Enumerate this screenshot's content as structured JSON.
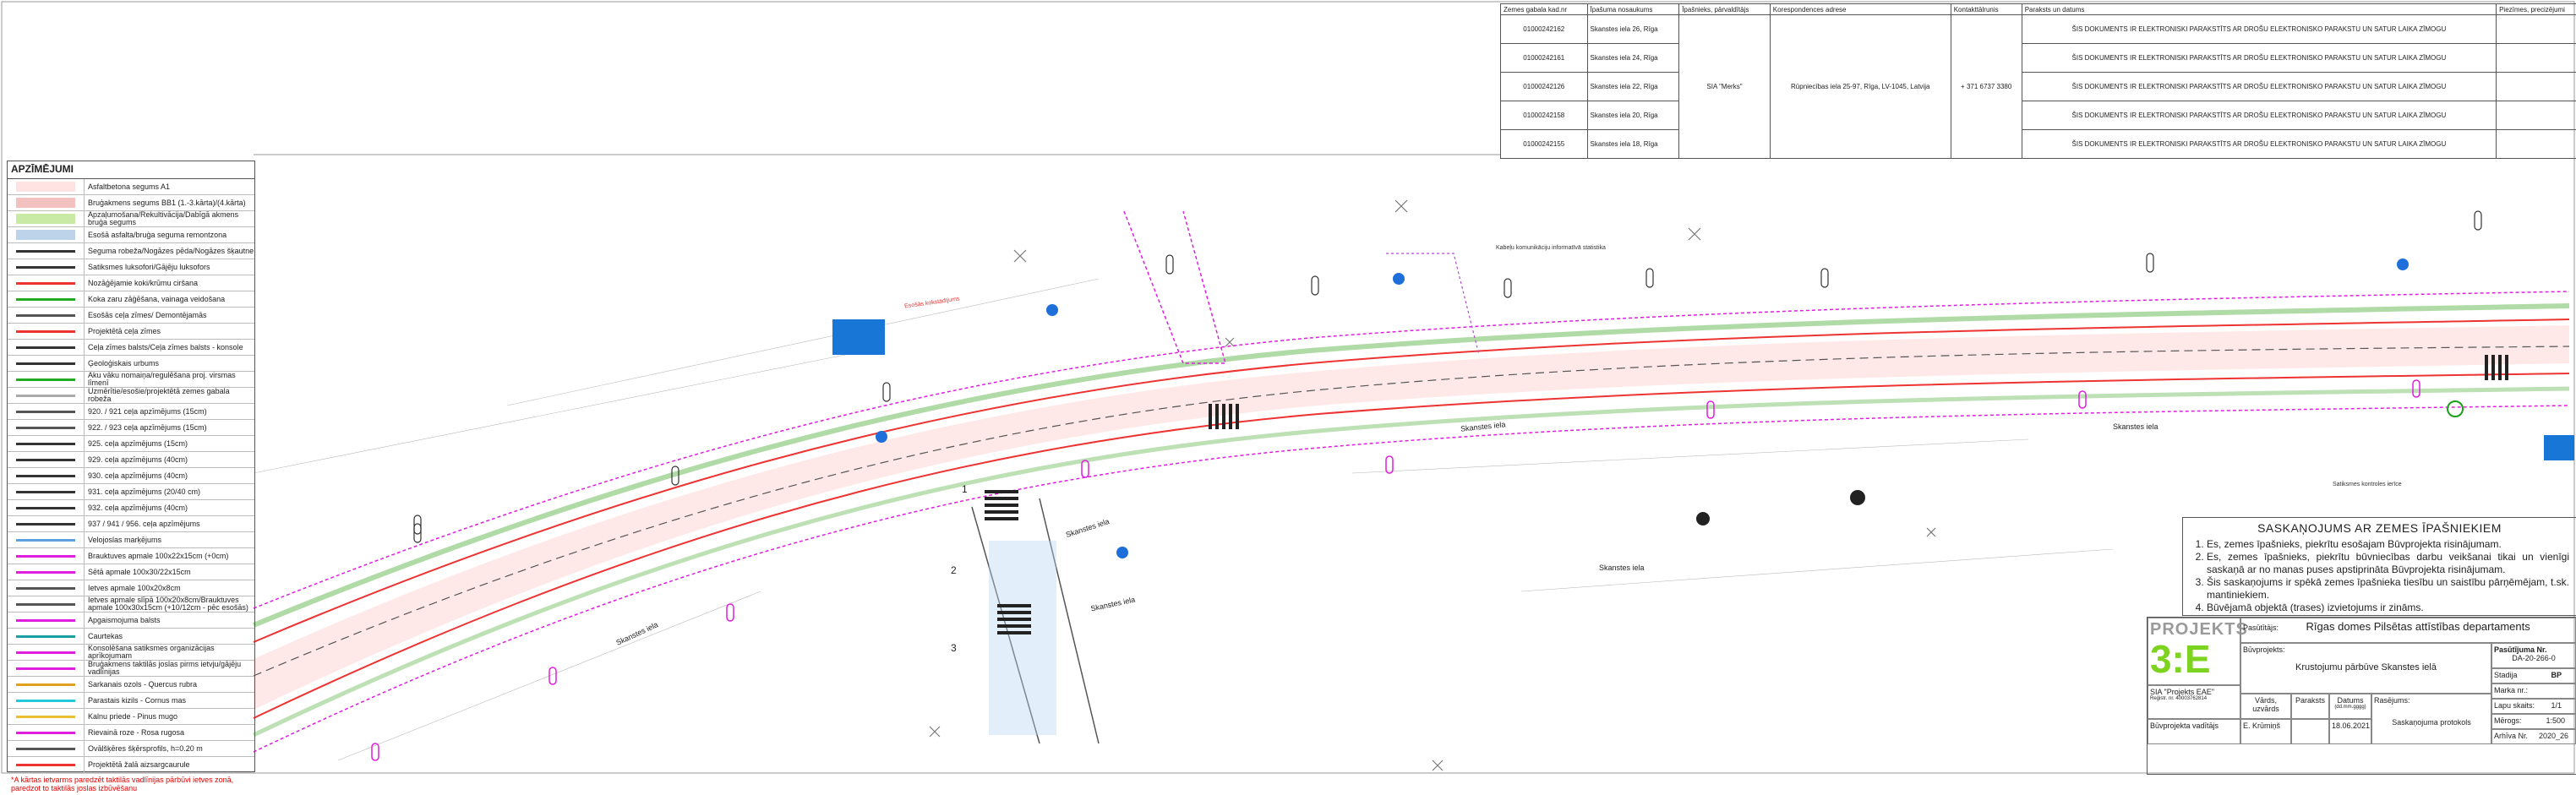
{
  "owners_table": {
    "headers": [
      "Zemes gabala kad.nr",
      "Īpašuma nosaukums",
      "Īpašnieks, pārvaldītājs",
      "Korespondences adrese",
      "Kontakttālrunis",
      "Paraksts un datums",
      "Piezīmes, precizējumi"
    ],
    "rows": [
      {
        "kad": "01000242162",
        "nos": "Skanstes iela 26, Rīga",
        "signature": "ŠIS DOKUMENTS IR ELEKTRONISKI PARAKSTĪTS AR DROŠU ELEKTRONISKO PARAKSTU UN SATUR LAIKA ZĪMOGU"
      },
      {
        "kad": "01000242161",
        "nos": "Skanstes iela 24, Rīga",
        "signature": "ŠIS DOKUMENTS IR ELEKTRONISKI PARAKSTĪTS AR DROŠU ELEKTRONISKO PARAKSTU UN SATUR LAIKA ZĪMOGU"
      },
      {
        "kad": "01000242126",
        "nos": "Skanstes iela 22, Rīga",
        "signature": "ŠIS DOKUMENTS IR ELEKTRONISKI PARAKSTĪTS AR DROŠU ELEKTRONISKO PARAKSTU UN SATUR LAIKA ZĪMOGU"
      },
      {
        "kad": "01000242158",
        "nos": "Skanstes iela 20, Rīga",
        "signature": "ŠIS DOKUMENTS IR ELEKTRONISKI PARAKSTĪTS AR DROŠU ELEKTRONISKO PARAKSTU UN SATUR LAIKA ZĪMOGU"
      },
      {
        "kad": "01000242155",
        "nos": "Skanstes iela 18, Rīga",
        "signature": "ŠIS DOKUMENTS IR ELEKTRONISKI PARAKSTĪTS AR DROŠU ELEKTRONISKO PARAKSTU UN SATUR LAIKA ZĪMOGU"
      }
    ],
    "owner": "SIA \"Merks\"",
    "address": "Rūpniecības iela 25-97, Rīga, LV-1045, Latvija",
    "phone": "+ 371 6737 3380"
  },
  "legend": {
    "title": "APZĪMĒJUMI",
    "items": [
      "Asfaltbetona segums A1",
      "Bruģakmens segums BB1 (1.-3.kārta)/(4.kārta)",
      "Apzaļumošana/Rekultivācija/Dabīgā akmens bruģa segums",
      "Esošā asfalta/bruģa seguma remontzona",
      "Seguma robeža/Nogāzes pēda/Nogāzes šķautne",
      "Satiksmes luksofori/Gājēju luksofors",
      "Nozāģējamie koki/krūmu ciršana",
      "Koka zaru zāģēšana, vainaga veidošana",
      "Esošās ceļa zīmes/ Demontējamās",
      "Projektētā ceļa zīmes",
      "Ceļa zīmes balsts/Ceļa zīmes balsts - konsole",
      "Ģeoloģiskais urbums",
      "Aku vāku nomaiņa/regulēšana proj. virsmas līmenī",
      "Uzmērītie/esošie/projektētā zemes gabala robeža",
      "920. / 921 ceļa apzīmējums (15cm)",
      "922. / 923 ceļa apzīmējums (15cm)",
      "925. ceļa apzīmējums (15cm)",
      "929. ceļa apzīmējums (40cm)",
      "930. ceļa apzīmējums (40cm)",
      "931. ceļa apzīmējums (20/40 cm)",
      "932. ceļa apzīmējums (40cm)",
      "937 / 941 / 956. ceļa apzīmējums",
      "Velojoslas marķējums",
      "Brauktuves apmale 100x22x15cm (+0cm)",
      "Sētā apmale 100x30/22x15cm",
      "Ietves apmale 100x20x8cm",
      "Ietves apmale slīpā 100x20x8cm/Brauktuves apmale 100x30x15cm (+10/12cm - pēc esošās)",
      "Apgaismojuma balsts",
      "Caurtekas",
      "Konsolēšana satiksmes organizācijas aprīkojumam",
      "Bruģakmens taktilās joslas pirms ietvju/gājēju vadlīnijas",
      "Sarkanais ozols - Quercus rubra",
      "Parastais kizils - Cornus mas",
      "Kalnu priede - Pinus mugo",
      "Rievainā roze - Rosa rugosa",
      "Ovālšķēres šķērsprofils, h=0.20 m",
      "Projektētā žalā aizsargcaurule"
    ],
    "note": "*A kārtas ietvarms paredzēt taktilās vadlīnijas pārbūvi ietves zonā, paredzot to taktilās joslas izbūvēšanu"
  },
  "map": {
    "street_labels": [
      "Skanstes iela",
      "Skanstes iela",
      "Skanstes iela",
      "Skanstes iela",
      "Skanstes iela",
      "Skanstes iela"
    ],
    "small_notes": [
      "Esošās kokstādījums",
      "Satiksmes kontroles ierīce",
      "Kabeļu komunikāciju informatīvā statistika"
    ],
    "numbers": [
      "1",
      "2",
      "3"
    ]
  },
  "agreement": {
    "title": "SASKAŅOJUMS AR ZEMES ĪPAŠNIEKIEM",
    "items": [
      "Es, zemes īpašnieks, piekrītu esošajam Būvprojekta risinājumam.",
      "Es, zemes īpašnieks, piekrītu būvniecības darbu veikšanai tikai un vienīgi saskaņā ar no manas puses apstiprināta Būvprojekta risinājumam.",
      "Šis saskaņojums ir spēkā zemes īpašnieka tiesību un saistību pārņēmējam, t.sk. mantiniekiem.",
      "Būvējamā objektā (trases) izvietojums ir zināms."
    ]
  },
  "title_block": {
    "logo_top": "PROJEKTS",
    "logo_big": "3:E",
    "company": "SIA \"Projekts EAE\"",
    "company_reg": "Reģistr. nr. 40003762814",
    "client_label": "Pasūtītājs:",
    "client": "Rīgas domes Pilsētas attīstības departaments",
    "project_label": "Būvprojekts:",
    "project": "Krustojumu pārbūve Skanstes ielā",
    "order_label": "Pasūtījuma Nr.",
    "order_no": "DA-20-266-0",
    "stage_label": "Stadija",
    "stage": "BP",
    "mark_label": "Marka nr.:",
    "sheet_label": "Lapu skaits:",
    "sheet": "1/1",
    "scale_label": "Mērogs:",
    "scale": "1:500",
    "archive_label": "Arhīva Nr.",
    "archive": "2020_26",
    "name_label": "Vārds, uzvārds",
    "sign_label": "Paraksts",
    "date_label": "Datums",
    "date_fmt": "(dd.mm.gggg)",
    "drawing_label": "Rasējums:",
    "role": "Būvprojekta vadītājs",
    "person": "E. Krūmiņš",
    "date": "18.06.2021",
    "drawing": "Saskaņojuma protokols"
  },
  "colors": {
    "road": "#ff6b6b",
    "greenbelt": "#7cc36b",
    "magenta": "#e01ee0",
    "blue": "#1e6fd9",
    "sign_blue": "#1877d6",
    "logo_green": "#7ed321"
  }
}
